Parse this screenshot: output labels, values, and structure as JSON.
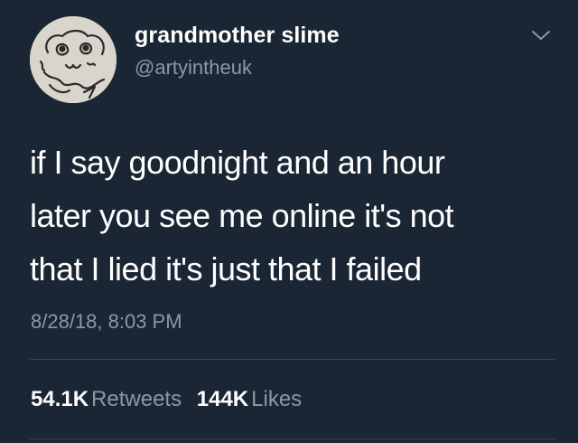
{
  "user": {
    "display_name": "grandmother slime",
    "handle": "@artyintheuk",
    "avatar_icon": "doodle-face-avatar"
  },
  "menu": {
    "icon": "chevron-down-icon"
  },
  "tweet": {
    "lines": [
      "if I say goodnight and an hour",
      "later you see me online it's not",
      "that I lied it's just that I failed"
    ],
    "timestamp": "8/28/18, 8:03 PM"
  },
  "stats": {
    "retweets_count": "54.1K",
    "retweets_label": "Retweets",
    "likes_count": "144K",
    "likes_label": "Likes"
  },
  "colors": {
    "background": "#1b2634",
    "primary_text": "#ffffff",
    "secondary_text": "#8899a6",
    "divider": "#38444d"
  }
}
